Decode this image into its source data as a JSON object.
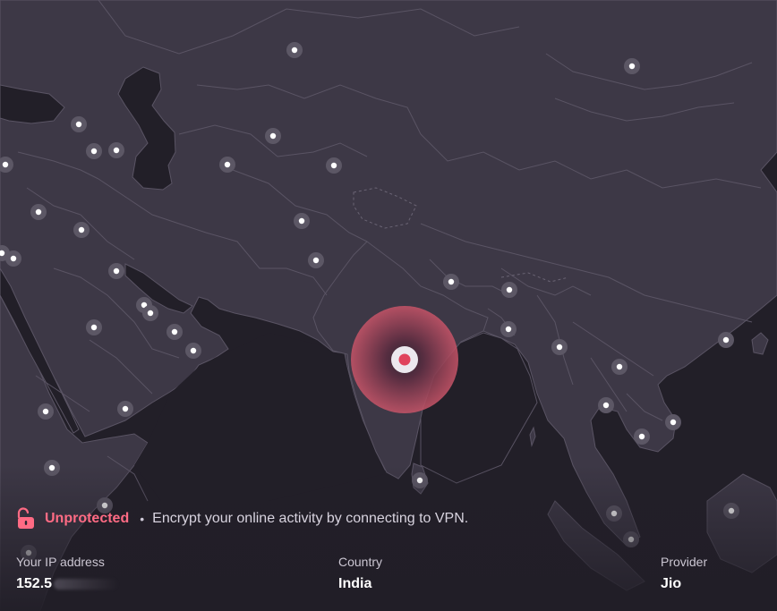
{
  "status": {
    "label": "Unprotected",
    "separator": "•",
    "description": "Encrypt your online activity by connecting to VPN."
  },
  "info": {
    "ip_label": "Your IP address",
    "ip_value": "152.5",
    "country_label": "Country",
    "country_value": "India",
    "provider_label": "Provider",
    "provider_value": "Jio"
  },
  "colors": {
    "background": "#2a2631",
    "land": "#3d3846",
    "water": "#221f28",
    "alert": "#ff6b84",
    "current_location_accent": "#e0425c"
  },
  "icons": {
    "status": "unlocked-padlock-icon",
    "map_node": "server-location-pin-icon",
    "current_location": "current-location-marker-icon"
  }
}
